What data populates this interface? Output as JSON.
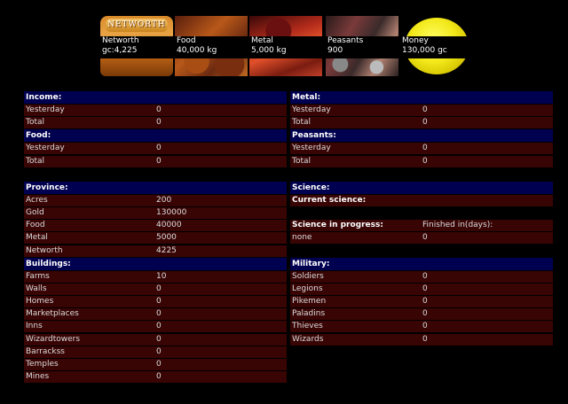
{
  "resources": [
    {
      "key": "networth",
      "banner": "NETWORTH",
      "name": "Networth",
      "value": "gc:4,225"
    },
    {
      "key": "food",
      "name": "Food",
      "value": "40,000 kg"
    },
    {
      "key": "metal",
      "name": "Metal",
      "value": "5,000 kg"
    },
    {
      "key": "peasants",
      "name": "Peasants",
      "value": "900"
    },
    {
      "key": "money",
      "name": "Money",
      "value": "130,000 gc"
    }
  ],
  "income": {
    "title": "Income:",
    "rows": [
      {
        "k": "Yesterday",
        "v": "0"
      },
      {
        "k": "Total",
        "v": "0"
      }
    ]
  },
  "metal": {
    "title": "Metal:",
    "rows": [
      {
        "k": "Yesterday",
        "v": "0"
      },
      {
        "k": "Total",
        "v": "0"
      }
    ]
  },
  "food": {
    "title": "Food:",
    "rows": [
      {
        "k": "Yesterday",
        "v": "0"
      },
      {
        "k": "Total",
        "v": "0"
      }
    ]
  },
  "peasants": {
    "title": "Peasants:",
    "rows": [
      {
        "k": "Yesterday",
        "v": "0"
      },
      {
        "k": "Total",
        "v": "0"
      }
    ]
  },
  "province": {
    "title": "Province:",
    "rows": [
      {
        "k": "Acres",
        "v": "200"
      },
      {
        "k": "Gold",
        "v": "130000"
      },
      {
        "k": "Food",
        "v": "40000"
      },
      {
        "k": "Metal",
        "v": "5000"
      },
      {
        "k": "Networth",
        "v": "4225"
      }
    ]
  },
  "science": {
    "title": "Science:",
    "current": "Current science:",
    "progress_label": "Science in progress:",
    "finished_label": "Finished in(days):",
    "progress_value": "none",
    "finished_value": "0"
  },
  "buildings": {
    "title": "Buildings:",
    "rows": [
      {
        "k": "Farms",
        "v": "10"
      },
      {
        "k": "Walls",
        "v": "0"
      },
      {
        "k": "Homes",
        "v": "0"
      },
      {
        "k": "Marketplaces",
        "v": "0"
      },
      {
        "k": "Inns",
        "v": "0"
      },
      {
        "k": "Wizardtowers",
        "v": "0"
      },
      {
        "k": "Barrackss",
        "v": "0"
      },
      {
        "k": "Temples",
        "v": "0"
      },
      {
        "k": "Mines",
        "v": "0"
      }
    ]
  },
  "military": {
    "title": "Military:",
    "rows": [
      {
        "k": "Soldiers",
        "v": "0"
      },
      {
        "k": "Legions",
        "v": "0"
      },
      {
        "k": "Pikemen",
        "v": "0"
      },
      {
        "k": "Paladins",
        "v": "0"
      },
      {
        "k": "Thieves",
        "v": "0"
      },
      {
        "k": "Wizards",
        "v": "0"
      }
    ]
  }
}
